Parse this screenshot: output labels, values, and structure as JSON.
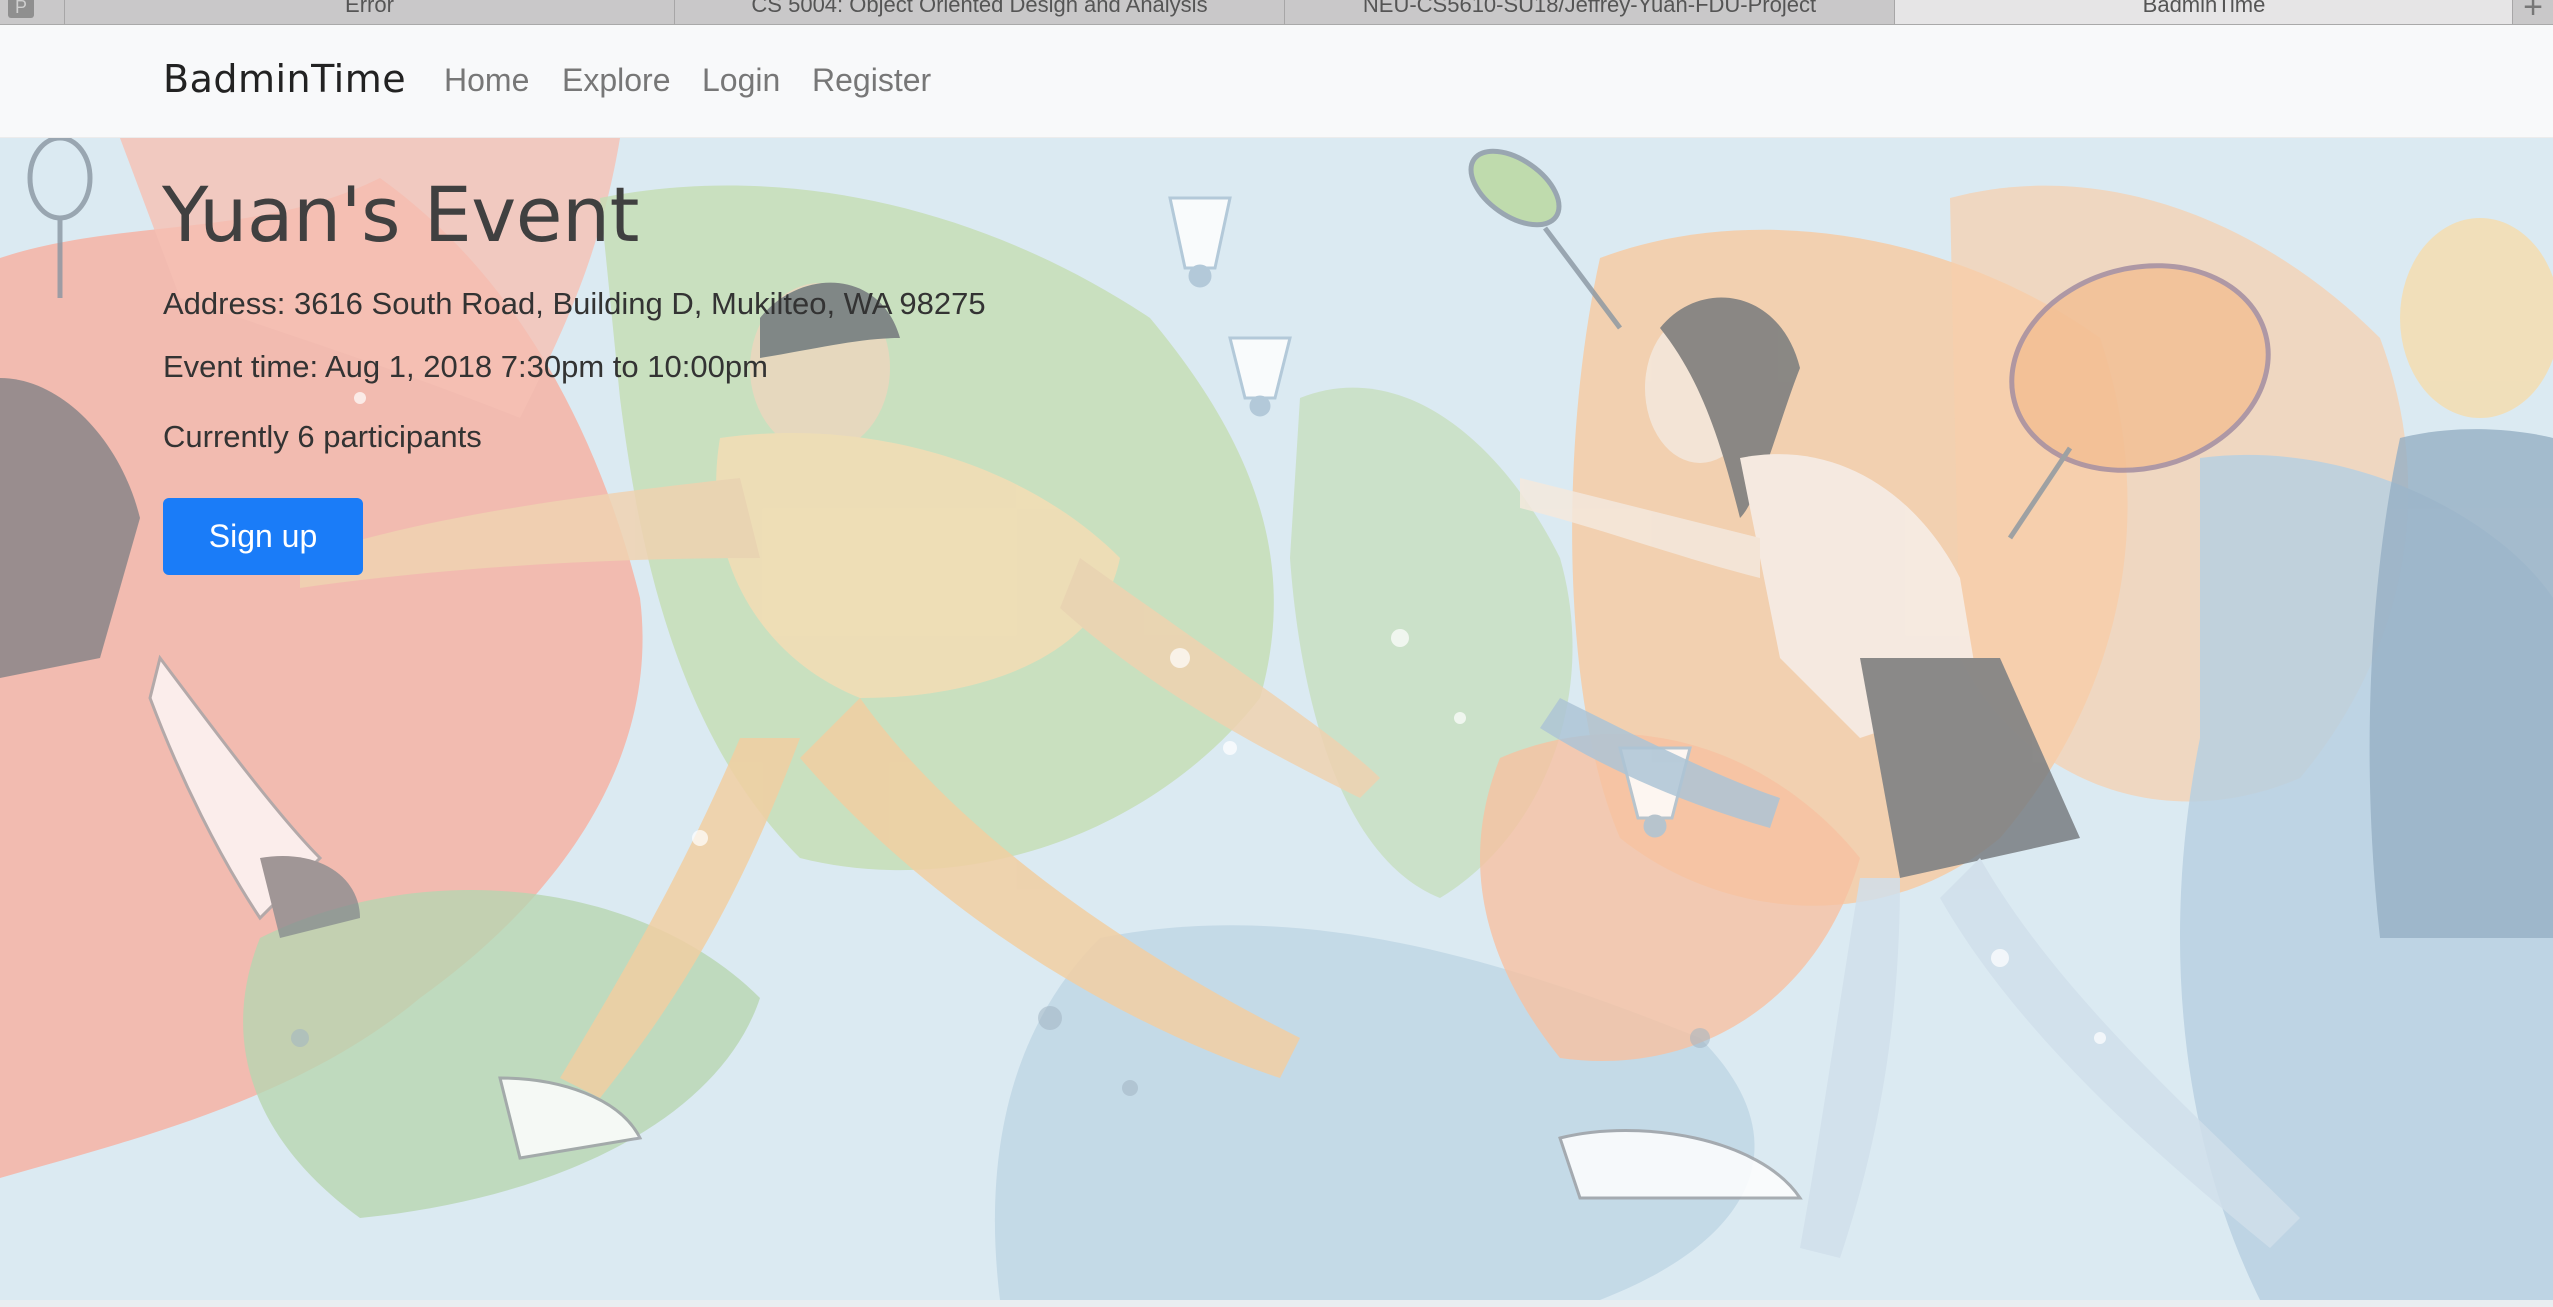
{
  "browser": {
    "tabs": [
      {
        "label": "Error",
        "active": false
      },
      {
        "label": "CS 5004: Object Oriented Design and Analysis",
        "active": false
      },
      {
        "label": "NEU-CS5610-SU18/Jeffrey-Yuan-FDU-Project",
        "active": false
      },
      {
        "label": "BadminTime",
        "active": true
      }
    ],
    "pin_icon": "pinned-tab-icon",
    "newtab_icon": "plus-icon"
  },
  "navbar": {
    "brand": "BadminTime",
    "links": [
      "Home",
      "Explore",
      "Login",
      "Register"
    ]
  },
  "event": {
    "title": "Yuan's Event",
    "address": "Address: 3616 South Road, Building D, Mukilteo, WA 98275",
    "time": "Event time: Aug 1, 2018 7:30pm to 10:00pm",
    "participants": "Currently 6 participants",
    "signup_label": "Sign up"
  },
  "colors": {
    "primary_button": "#1a7cf8",
    "navbar_bg": "#f8f9fa",
    "hero_sky": "#d4e6f0"
  }
}
